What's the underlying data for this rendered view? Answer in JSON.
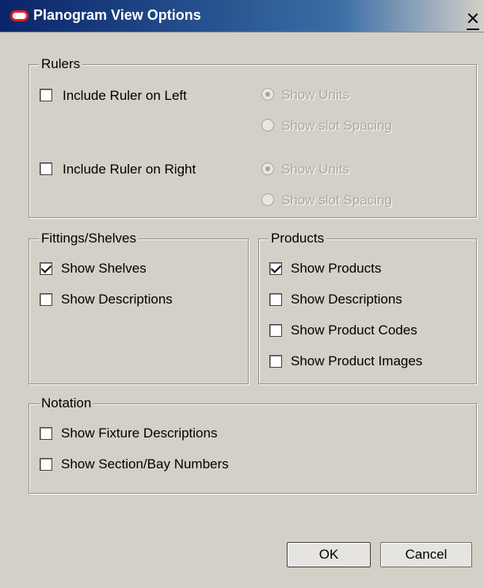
{
  "window": {
    "title": "Planogram View Options",
    "close_glyph": "X",
    "icon": "oracle-logo-icon",
    "colors": {
      "title_start": "#0a246a",
      "title_end": "#3a6ea5",
      "background": "#d4d0c8"
    }
  },
  "rulers": {
    "legend": "Rulers",
    "left": {
      "label": "Include Ruler on Left",
      "checked": false,
      "options": [
        {
          "label": "Show Units",
          "selected": true,
          "enabled": false
        },
        {
          "label": "Show slot Spacing",
          "selected": false,
          "enabled": false
        }
      ]
    },
    "right": {
      "label": "Include Ruler on Right",
      "checked": false,
      "options": [
        {
          "label": "Show Units",
          "selected": true,
          "enabled": false
        },
        {
          "label": "Show slot Spacing",
          "selected": false,
          "enabled": false
        }
      ]
    }
  },
  "fittings": {
    "legend": "Fittings/Shelves",
    "items": [
      {
        "label": "Show Shelves",
        "checked": true
      },
      {
        "label": "Show Descriptions",
        "checked": false
      }
    ]
  },
  "products": {
    "legend": "Products",
    "items": [
      {
        "label": "Show Products",
        "checked": true
      },
      {
        "label": "Show Descriptions",
        "checked": false
      },
      {
        "label": "Show Product Codes",
        "checked": false
      },
      {
        "label": "Show Product Images",
        "checked": false
      }
    ]
  },
  "notation": {
    "legend": "Notation",
    "items": [
      {
        "label": "Show Fixture Descriptions",
        "checked": false
      },
      {
        "label": "Show Section/Bay Numbers",
        "checked": false
      }
    ]
  },
  "buttons": {
    "ok": "OK",
    "cancel": "Cancel"
  }
}
